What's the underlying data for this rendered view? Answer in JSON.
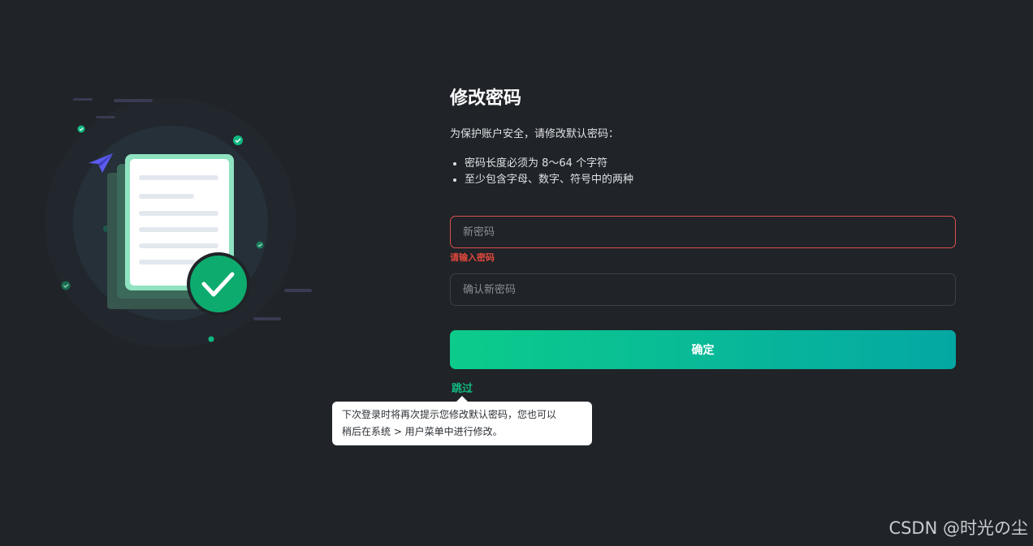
{
  "page": {
    "title": "修改密码",
    "intro": "为保护账户安全，请修改默认密码：",
    "rules": [
      "密码长度必须为 8～64 个字符",
      "至少包含字母、数字、符号中的两种"
    ]
  },
  "form": {
    "new_password": {
      "placeholder": "新密码",
      "value": "",
      "error": "请输入密码"
    },
    "confirm_password": {
      "placeholder": "确认新密码",
      "value": ""
    },
    "submit_label": "确定",
    "skip_label": "跳过"
  },
  "tooltip": {
    "text_line1": "下次登录时将再次提示您修改默认密码，您也可以",
    "text_line2": "稍后在系统 > 用户菜单中进行修改。"
  },
  "watermark": "CSDN @时光の尘",
  "colors": {
    "background": "#202327",
    "accent_green": "#10b981",
    "gradient_start": "#0ccb8b",
    "gradient_end": "#04a8a3",
    "error_red": "#e0483d",
    "paper_plane": "#5b5bf0"
  },
  "icons": {
    "illustration": "document-check-illustration",
    "paper_plane": "paper-plane-icon",
    "check": "check-icon"
  }
}
